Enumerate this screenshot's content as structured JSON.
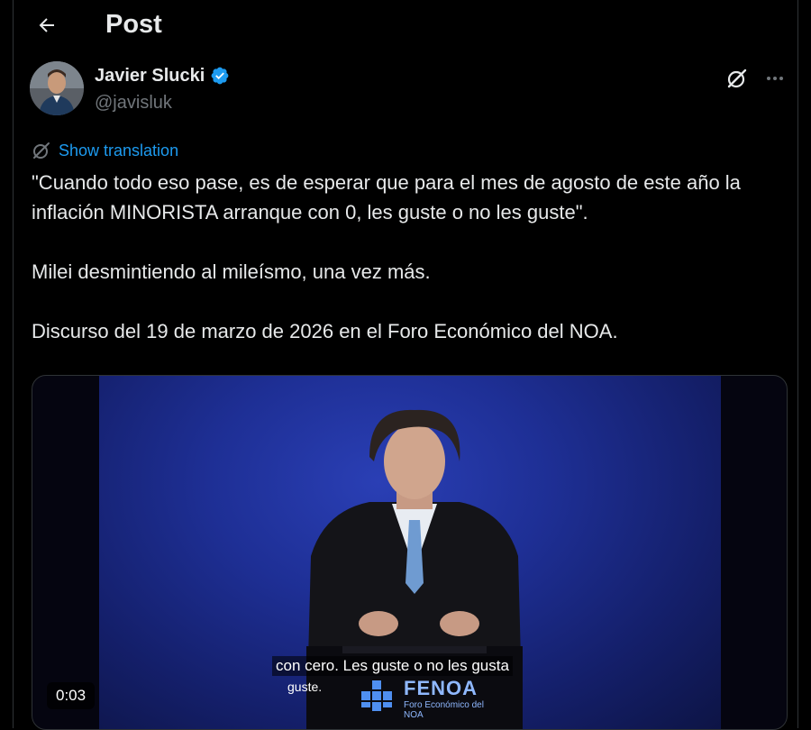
{
  "header": {
    "title": "Post",
    "back_icon": "arrow-left-icon"
  },
  "author": {
    "name": "Javier Slucki",
    "handle": "@javisluk",
    "verified": true,
    "verified_color": "#1d9bf0"
  },
  "actions": {
    "grok_icon": "grok-icon",
    "more_icon": "more-horizontal-icon"
  },
  "translation": {
    "label": "Show translation",
    "icon": "translate-icon"
  },
  "tweet": {
    "paragraphs": [
      "\"Cuando todo eso pase, es de esperar que para el mes de agosto de este año la inflación MINORISTA arranque con 0, les guste o no les guste\".",
      "Milei desmintiendo al mileísmo, una vez más.",
      "Discurso del 19 de marzo de 2026 en el Foro Económico del NOA."
    ]
  },
  "media": {
    "type": "video",
    "timestamp": "0:03",
    "caption_line1": "con cero. Les guste o no les gusta",
    "caption_line2": "guste.",
    "logo_title": "FENOA",
    "logo_subtitle": "Foro Económico del NOA"
  },
  "colors": {
    "accent": "#1d9bf0",
    "background": "#000000",
    "text": "#e7e9ea",
    "muted": "#71767b"
  }
}
